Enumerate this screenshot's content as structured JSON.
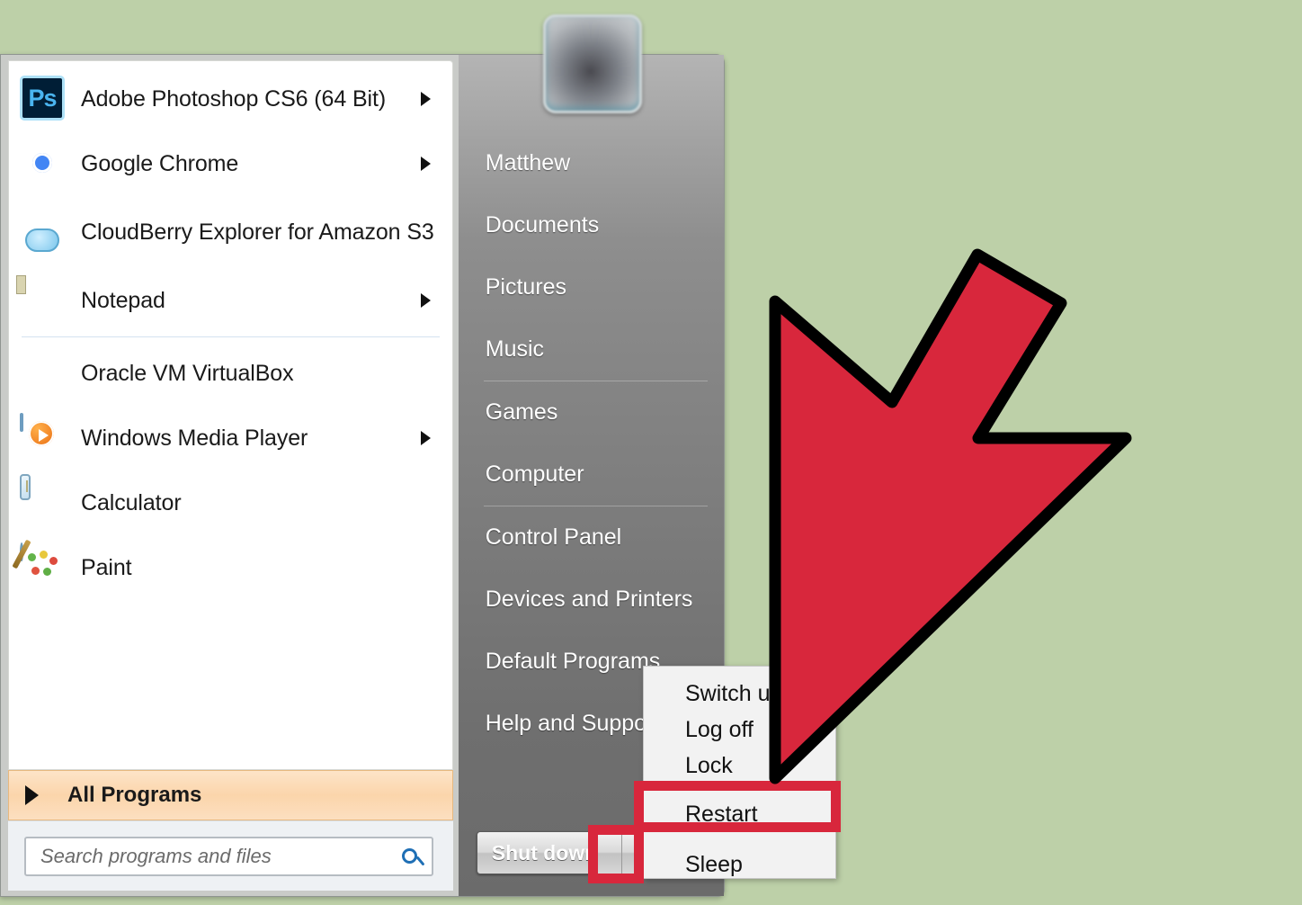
{
  "desktop": {
    "background_color": "#bdd0a8"
  },
  "start_menu": {
    "avatar": "user-avatar",
    "programs": [
      {
        "label": "Adobe Photoshop CS6 (64 Bit)",
        "icon": "photoshop-icon",
        "has_submenu": true,
        "separator_after": false
      },
      {
        "label": "Google Chrome",
        "icon": "chrome-icon",
        "has_submenu": true,
        "separator_after": false
      },
      {
        "label": "CloudBerry Explorer for Amazon S3",
        "icon": "cloudberry-icon",
        "has_submenu": false,
        "separator_after": false
      },
      {
        "label": "Notepad",
        "icon": "notepad-icon",
        "has_submenu": true,
        "separator_after": true
      },
      {
        "label": "Oracle VM VirtualBox",
        "icon": "virtualbox-icon",
        "has_submenu": false,
        "separator_after": false
      },
      {
        "label": "Windows Media Player",
        "icon": "media-player-icon",
        "has_submenu": true,
        "separator_after": false
      },
      {
        "label": "Calculator",
        "icon": "calculator-icon",
        "has_submenu": false,
        "separator_after": false
      },
      {
        "label": "Paint",
        "icon": "paint-icon",
        "has_submenu": false,
        "separator_after": false
      }
    ],
    "all_programs": {
      "label": "All Programs",
      "arrow_icon": "chevron-right-icon"
    },
    "search": {
      "placeholder": "Search programs and files",
      "value": "",
      "icon": "search-icon"
    },
    "right_links": [
      {
        "label": "Matthew",
        "separator_after": false
      },
      {
        "label": "Documents",
        "separator_after": false
      },
      {
        "label": "Pictures",
        "separator_after": false
      },
      {
        "label": "Music",
        "separator_after": true
      },
      {
        "label": "Games",
        "separator_after": false
      },
      {
        "label": "Computer",
        "separator_after": true
      },
      {
        "label": "Control Panel",
        "separator_after": false
      },
      {
        "label": "Devices and Printers",
        "separator_after": false
      },
      {
        "label": "Default Programs",
        "separator_after": false
      },
      {
        "label": "Help and Support",
        "separator_after": false
      }
    ],
    "shutdown": {
      "label": "Shut down",
      "split_arrow_icon": "triangle-right-icon"
    },
    "shutdown_menu": {
      "items": [
        {
          "label": "Switch user",
          "highlighted": false
        },
        {
          "label": "Log off",
          "highlighted": false
        },
        {
          "label": "Lock",
          "highlighted": false
        },
        {
          "label": "Restart",
          "highlighted": true
        },
        {
          "label": "Sleep",
          "highlighted": false
        }
      ]
    }
  },
  "annotations": {
    "highlight_color": "#d8273c",
    "arrow": {
      "icon": "red-pointer-arrow",
      "fill": "#d8273c",
      "stroke": "#000000",
      "points_at": "Restart"
    },
    "boxes": [
      {
        "target": "Restart"
      },
      {
        "target": "shutdown-split-arrow"
      }
    ]
  }
}
